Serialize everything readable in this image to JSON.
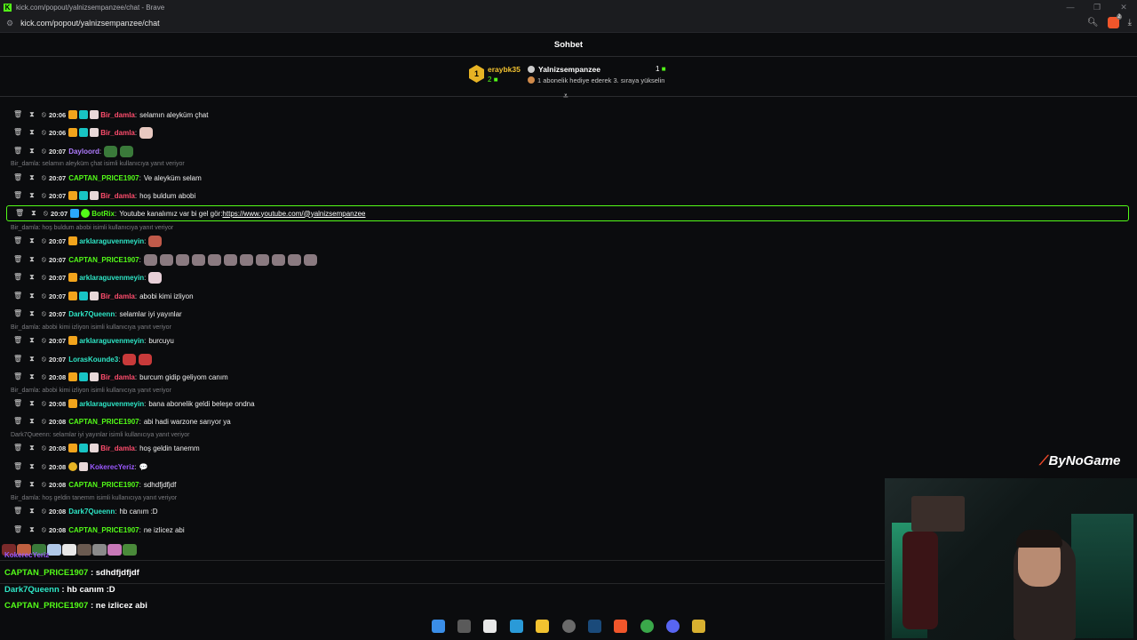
{
  "browser": {
    "window_title": "kick.com/popout/yalnizsempanzee/chat - Brave",
    "url": "kick.com/popout/yalnizsempanzee/chat",
    "brave_badge": "2"
  },
  "chat": {
    "title": "Sohbet",
    "leaderboard": {
      "first_user": "eraybk35",
      "first_count": "2",
      "first_rank": "1",
      "second_user": "Yalnizsempanzee",
      "second_sub": "1 abonelik hediye ederek 3. sıraya yükselin",
      "second_count": "1"
    },
    "messages": [
      {
        "time": "20:06",
        "user": "Bir_damla",
        "text": "selamın aleyküm çhat"
      },
      {
        "time": "20:06",
        "user": "Bir_damla",
        "text": ""
      },
      {
        "time": "20:07",
        "user": "Dayloord",
        "text": ""
      },
      {
        "reply": "Bir_damla: selamın aleyküm çhat isimli kullanıcıya yanıt veriyor"
      },
      {
        "time": "20:07",
        "user": "CAPTAN_PRICE1907",
        "text": "Ve aleyküm selam"
      },
      {
        "time": "20:07",
        "user": "Bir_damla",
        "text": "hoş buldum abobi"
      },
      {
        "time": "20:07",
        "user": "BotRix",
        "text": "Youtube kanalımız var bi gel gör: ",
        "link": "https://www.youtube.com/@yalnizsempanzee"
      },
      {
        "reply": "Bir_damla: hoş buldum abobi isimli kullanıcıya yanıt veriyor"
      },
      {
        "time": "20:07",
        "user": "arklaraguvenmeyin",
        "text": ""
      },
      {
        "time": "20:07",
        "user": "CAPTAN_PRICE1907",
        "text": ""
      },
      {
        "time": "20:07",
        "user": "arklaraguvenmeyin",
        "text": ""
      },
      {
        "time": "20:07",
        "user": "Bir_damla",
        "text": "abobi kimi izliyon"
      },
      {
        "time": "20:07",
        "user": "Dark7Queenn",
        "text": "selamlar iyi yayınlar"
      },
      {
        "reply": "Bir_damla: abobi kimi izliyon isimli kullanıcıya yanıt veriyor"
      },
      {
        "time": "20:07",
        "user": "arklaraguvenmeyin",
        "text": "burcuyu"
      },
      {
        "time": "20:07",
        "user": "LorasKounde3",
        "text": ""
      },
      {
        "time": "20:08",
        "user": "Bir_damla",
        "text": "burcum gidip geliyom canım"
      },
      {
        "reply": "Bir_damla: abobi kimi izliyon isimli kullanıcıya yanıt veriyor"
      },
      {
        "time": "20:08",
        "user": "arklaraguvenmeyin",
        "text": "bana abonelik geldi beleşe ondna"
      },
      {
        "time": "20:08",
        "user": "CAPTAN_PRICE1907",
        "text": "abi hadi warzone sarıyor ya"
      },
      {
        "reply": "Dark7Queenn: selamlar iyi yayınlar isimli kullanıcıya yanıt veriyor"
      },
      {
        "time": "20:08",
        "user": "Bir_damla",
        "text": "hoş geldin tanemm"
      },
      {
        "time": "20:08",
        "user": "KokerecYeriz",
        "text": ""
      },
      {
        "time": "20:08",
        "user": "CAPTAN_PRICE1907",
        "text": "sdhdfjdfjdf"
      },
      {
        "reply": "Bir_damla: hoş geldin tanemm isimli kullanıcıya yanıt veriyor"
      },
      {
        "time": "20:08",
        "user": "Dark7Queenn",
        "text": "hb canım :D"
      },
      {
        "time": "20:08",
        "user": "CAPTAN_PRICE1907",
        "text": "ne izlicez abi"
      }
    ],
    "colors": {
      "Bir_damla": "#ff4d6d",
      "Dayloord": "#b07cff",
      "CAPTAN_PRICE1907": "#53fc18",
      "BotRix": "#53fc18",
      "arklaraguvenmeyin": "#2ee6c6",
      "Dark7Queenn": "#2ee6c6",
      "LorasKounde3": "#2ee6c6",
      "KokerecYeriz": "#9b59ff"
    }
  },
  "overlay": {
    "top_user": "KokerecYeriz",
    "line1_user": "CAPTAN_PRICE1907",
    "line1_text": " : sdhdfjdfjdf",
    "line2_user": "Dark7Queenn",
    "line2_text": " : hb canım :D",
    "line3_user": "CAPTAN_PRICE1907",
    "line3_text": " : ne izlicez abi",
    "brand": "ByNoGame"
  }
}
